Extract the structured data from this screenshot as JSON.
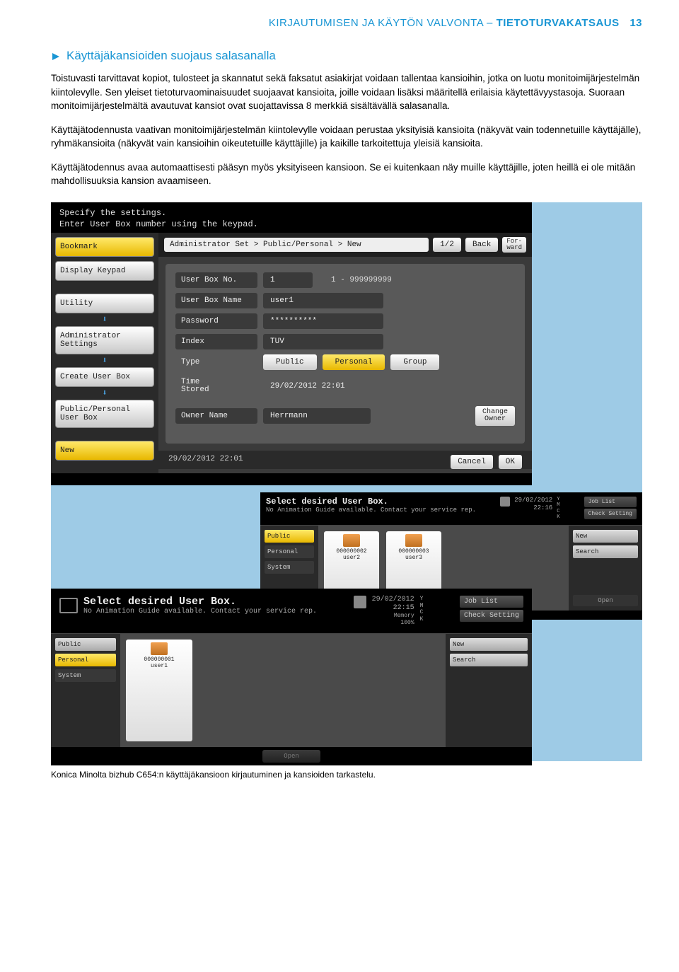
{
  "header": {
    "left": "KIRJAUTUMISEN JA KÄYTÖN VALVONTA – ",
    "bold": "TIETOTURVAKATSAUS",
    "page": "13"
  },
  "section": {
    "title": "Käyttäjäkansioiden suojaus salasanalla"
  },
  "para1": "Toistuvasti tarvittavat kopiot, tulosteet ja skannatut sekä faksatut asiakirjat voidaan tallentaa kansioihin, jotka on luotu monitoimijärjestelmän kiintolevylle. Sen yleiset tietoturvaominaisuudet suojaavat kansioita, joille voidaan lisäksi määritellä erilaisia käytettävyystasoja. Suoraan monitoimijärjestelmältä avautuvat kansiot ovat suojattavissa 8 merkkiä sisältävällä salasanalla.",
  "para2": "Käyttäjätodennusta vaativan monitoimijärjestelmän kiintolevylle voidaan perustaa yksityisiä kansioita (näkyvät vain todennetuille käyttäjälle), ryhmäkansioita (näkyvät vain kansioihin oikeutetuille käyttäjille) ja kaikille tarkoitettuja yleisiä kansioita.",
  "para3": "Käyttäjätodennus avaa automaattisesti pääsyn myös yksityiseen kansioon. Se ei kuitenkaan näy muille käyttäjille, joten heillä ei ole mitään mahdollisuuksia kansion avaamiseen.",
  "shot1": {
    "instr1": "Specify the settings.",
    "instr2": "Enter User Box number using the keypad.",
    "bookmark": "Bookmark",
    "display_keypad": "Display Keypad",
    "utility": "Utility",
    "admin_settings": "Administrator\nSettings",
    "create_box": "Create User Box",
    "pubper": "Public/Personal\nUser Box",
    "new": "New",
    "breadcrumb": "Administrator Set > Public/Personal > New",
    "page_ind": "1/2",
    "back": "Back",
    "forward": "For-\nward",
    "f_boxno": "User Box No.",
    "v_boxno": "1",
    "h_boxno": "1 - 999999999",
    "f_boxname": "User Box Name",
    "v_boxname": "user1",
    "f_password": "Password",
    "v_password": "**********",
    "f_index": "Index",
    "v_index": "TUV",
    "f_type": "Type",
    "t_public": "Public",
    "t_personal": "Personal",
    "t_group": "Group",
    "f_time": "Time\nStored",
    "v_time": "29/02/2012  22:01",
    "f_owner": "Owner Name",
    "v_owner": "Herrmann",
    "chg_owner": "Change\nOwner",
    "stamp": "29/02/2012  22:01",
    "cancel": "Cancel",
    "ok": "OK"
  },
  "shot2": {
    "title": "Select desired User Box.",
    "sub": "No Animation Guide available. Contact your service rep.",
    "joblist": "Job List",
    "date": "29/02/2012\n22:16",
    "cmyk": "Y\nM\nC\nK",
    "chk": "Check Setting",
    "tabs": {
      "public": "Public",
      "personal": "Personal",
      "system": "System"
    },
    "u2id": "000000002",
    "u2": "user2",
    "u3id": "000000003",
    "u3": "user3",
    "new": "New",
    "search": "Search",
    "open": "Open"
  },
  "shot3": {
    "title": "Select desired User Box.",
    "sub": "No Animation Guide available. Contact your service rep.",
    "joblist": "Job List",
    "date": "29/02/2012\n22:15",
    "cmyk": "Y\nM\nC\nK",
    "mem": "Memory\n100%",
    "chk": "Check Setting",
    "tabs": {
      "public": "Public",
      "personal": "Personal",
      "system": "System"
    },
    "u1id": "000000001",
    "u1": "user1",
    "new": "New",
    "search": "Search",
    "open": "Open"
  },
  "caption": "Konica Minolta bizhub C654:n käyttäjäkansioon kirjautuminen ja kansioiden tarkastelu."
}
